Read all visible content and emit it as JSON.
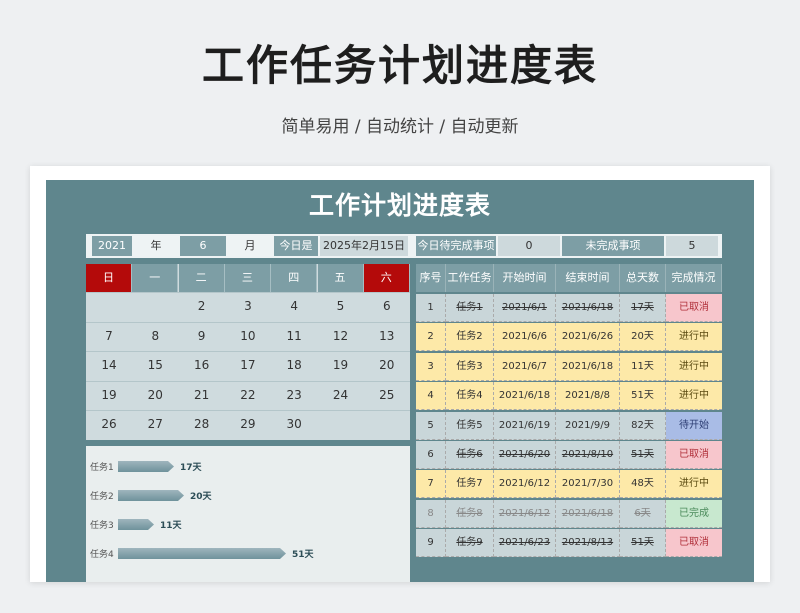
{
  "header": {
    "title": "工作任务计划进度表",
    "subtitle": "简单易用 / 自动统计 / 自动更新"
  },
  "sheet": {
    "title": "工作计划进度表",
    "info": {
      "year": "2021",
      "year_unit": "年",
      "month": "6",
      "month_unit": "月",
      "today_label": "今日是",
      "today_value": "2025年2月15日",
      "pending_label": "今日待完成事项",
      "pending_value": "0",
      "unfinished_label": "未完成事项",
      "unfinished_value": "5"
    },
    "calendar": {
      "weekdays": [
        "日",
        "一",
        "二",
        "三",
        "四",
        "五",
        "六"
      ],
      "weeks": [
        [
          "",
          "",
          "2",
          "3",
          "4",
          "5",
          "6"
        ],
        [
          "7",
          "8",
          "9",
          "10",
          "11",
          "12",
          "13"
        ],
        [
          "14",
          "15",
          "16",
          "17",
          "18",
          "19",
          "20"
        ],
        [
          "19",
          "20",
          "21",
          "22",
          "23",
          "24",
          "25"
        ],
        [
          "26",
          "27",
          "28",
          "29",
          "30",
          "",
          ""
        ]
      ]
    },
    "bars": [
      {
        "label": "任务1",
        "value": "17天",
        "days": 17
      },
      {
        "label": "任务2",
        "value": "20天",
        "days": 20
      },
      {
        "label": "任务3",
        "value": "11天",
        "days": 11
      },
      {
        "label": "任务4",
        "value": "51天",
        "days": 51
      }
    ],
    "table": {
      "headers": [
        "序号",
        "工作任务",
        "开始时间",
        "结束时间",
        "总天数",
        "完成情况"
      ],
      "rows": [
        {
          "no": "1",
          "task": "任务1",
          "start": "2021/6/1",
          "end": "2021/6/18",
          "days": "17天",
          "status": "已取消",
          "kind": "cancel"
        },
        {
          "no": "2",
          "task": "任务2",
          "start": "2021/6/6",
          "end": "2021/6/26",
          "days": "20天",
          "status": "进行中",
          "kind": "doing"
        },
        {
          "no": "3",
          "task": "任务3",
          "start": "2021/6/7",
          "end": "2021/6/18",
          "days": "11天",
          "status": "进行中",
          "kind": "doing"
        },
        {
          "no": "4",
          "task": "任务4",
          "start": "2021/6/18",
          "end": "2021/8/8",
          "days": "51天",
          "status": "进行中",
          "kind": "doing"
        },
        {
          "no": "5",
          "task": "任务5",
          "start": "2021/6/19",
          "end": "2021/9/9",
          "days": "82天",
          "status": "待开始",
          "kind": "pending"
        },
        {
          "no": "6",
          "task": "任务6",
          "start": "2021/6/20",
          "end": "2021/8/10",
          "days": "51天",
          "status": "已取消",
          "kind": "cancel"
        },
        {
          "no": "7",
          "task": "任务7",
          "start": "2021/6/12",
          "end": "2021/7/30",
          "days": "48天",
          "status": "进行中",
          "kind": "doing"
        },
        {
          "no": "8",
          "task": "任务8",
          "start": "2021/6/12",
          "end": "2021/6/18",
          "days": "6天",
          "status": "已完成",
          "kind": "done"
        },
        {
          "no": "9",
          "task": "任务9",
          "start": "2021/6/23",
          "end": "2021/8/13",
          "days": "51天",
          "status": "已取消",
          "kind": "cancel"
        }
      ]
    },
    "colors": {
      "doing_bg": "#fde9a8",
      "cancel_bg": "#f7c6cc",
      "pending_bg": "#a9bce6",
      "done_bg": "#c8e8cf",
      "plain_bg": "#c9d6d9"
    }
  }
}
